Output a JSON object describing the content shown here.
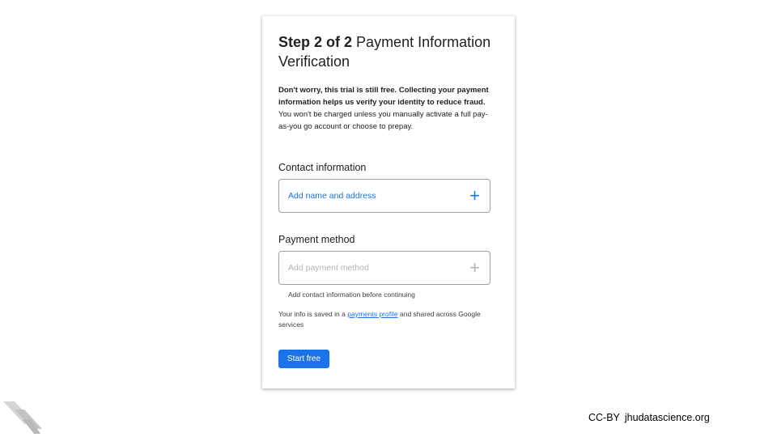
{
  "card": {
    "step_label": "Step 2 of 2",
    "title": "Payment Information Verification",
    "intro_bold": "Don't worry, this trial is still free. Collecting your payment information helps us verify your identity to reduce fraud.",
    "intro_rest": "You won't be charged unless you manually activate a full pay-as-you go account or choose to prepay.",
    "contact_section_label": "Contact information",
    "contact_field_label": "Add name and address",
    "payment_section_label": "Payment method",
    "payment_field_label": "Add payment method",
    "payment_helper": "Add contact information before continuing",
    "saved_prefix": "Your info is saved in a",
    "saved_link": "payments profile",
    "saved_suffix": "and shared across Google services",
    "start_button": "Start free"
  },
  "footer": {
    "license": "CC-BY",
    "site": "jhudatascience.org"
  },
  "icons": {
    "contact_add": "plus-icon",
    "payment_add": "plus-icon",
    "corner": "stripes-logo-icon"
  },
  "colors": {
    "accent": "#1a73e8",
    "disabled": "#b0b4b8",
    "text": "#202124"
  }
}
